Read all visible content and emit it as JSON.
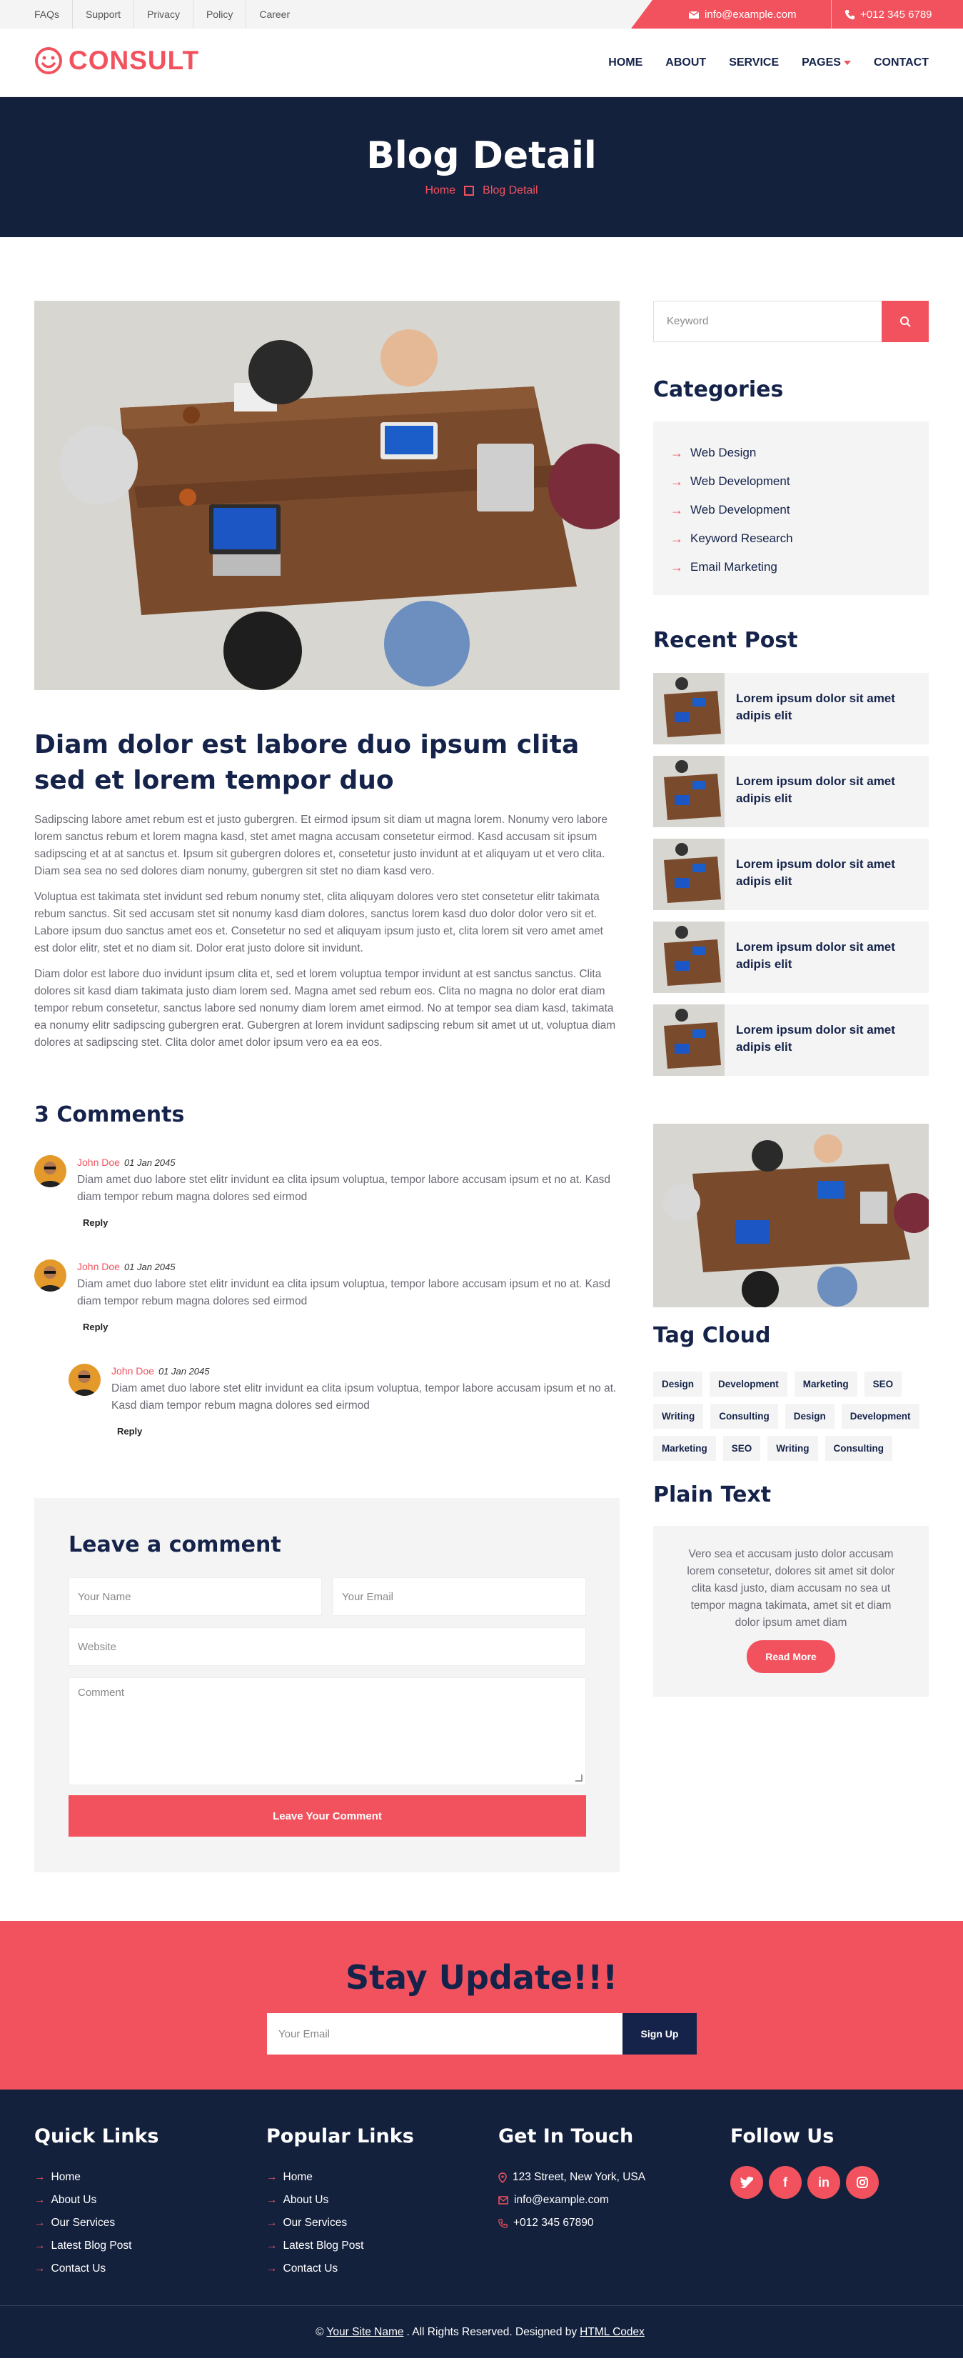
{
  "topbar": {
    "links": [
      "FAQs",
      "Support",
      "Privacy",
      "Policy",
      "Career"
    ],
    "email": "info@example.com",
    "phone": "+012 345 6789"
  },
  "nav": {
    "brand": "CONSULT",
    "items": [
      "HOME",
      "ABOUT",
      "SERVICE",
      "PAGES",
      "CONTACT"
    ],
    "active": "PAGES"
  },
  "header": {
    "title": "Blog Detail",
    "breadcrumb": [
      "Home",
      "Blog Detail"
    ]
  },
  "post": {
    "title": "Diam dolor est labore duo ipsum clita sed et lorem tempor duo",
    "paragraphs": [
      "Sadipscing labore amet rebum est et justo gubergren. Et eirmod ipsum sit diam ut magna lorem. Nonumy vero labore lorem sanctus rebum et lorem magna kasd, stet amet magna accusam consetetur eirmod. Kasd accusam sit ipsum sadipscing et at at sanctus et. Ipsum sit gubergren dolores et, consetetur justo invidunt at et aliquyam ut et vero clita. Diam sea sea no sed dolores diam nonumy, gubergren sit stet no diam kasd vero.",
      "Voluptua est takimata stet invidunt sed rebum nonumy stet, clita aliquyam dolores vero stet consetetur elitr takimata rebum sanctus. Sit sed accusam stet sit nonumy kasd diam dolores, sanctus lorem kasd duo dolor dolor vero sit et. Labore ipsum duo sanctus amet eos et. Consetetur no sed et aliquyam ipsum justo et, clita lorem sit vero amet amet est dolor elitr, stet et no diam sit. Dolor erat justo dolore sit invidunt.",
      "Diam dolor est labore duo invidunt ipsum clita et, sed et lorem voluptua tempor invidunt at est sanctus sanctus. Clita dolores sit kasd diam takimata justo diam lorem sed. Magna amet sed rebum eos. Clita no magna no dolor erat diam tempor rebum consetetur, sanctus labore sed nonumy diam lorem amet eirmod. No at tempor sea diam kasd, takimata ea nonumy elitr sadipscing gubergren erat. Gubergren at lorem invidunt sadipscing rebum sit amet ut ut, voluptua diam dolores at sadipscing stet. Clita dolor amet dolor ipsum vero ea ea eos."
    ]
  },
  "comments": {
    "heading": "3 Comments",
    "items": [
      {
        "name": "John Doe",
        "date": "01 Jan 2045",
        "text": "Diam amet duo labore stet elitr invidunt ea clita ipsum voluptua, tempor labore accusam ipsum et no at. Kasd diam tempor rebum magna dolores sed eirmod",
        "reply": "Reply"
      },
      {
        "name": "John Doe",
        "date": "01 Jan 2045",
        "text": "Diam amet duo labore stet elitr invidunt ea clita ipsum voluptua, tempor labore accusam ipsum et no at. Kasd diam tempor rebum magna dolores sed eirmod",
        "reply": "Reply"
      },
      {
        "name": "John Doe",
        "date": "01 Jan 2045",
        "text": "Diam amet duo labore stet elitr invidunt ea clita ipsum voluptua, tempor labore accusam ipsum et no at. Kasd diam tempor rebum magna dolores sed eirmod",
        "reply": "Reply"
      }
    ]
  },
  "form": {
    "heading": "Leave a comment",
    "name_placeholder": "Your Name",
    "email_placeholder": "Your Email",
    "website_placeholder": "Website",
    "comment_placeholder": "Comment",
    "submit": "Leave Your Comment"
  },
  "sidebar": {
    "search_placeholder": "Keyword",
    "categories_heading": "Categories",
    "categories": [
      "Web Design",
      "Web Development",
      "Web Development",
      "Keyword Research",
      "Email Marketing"
    ],
    "recent_heading": "Recent Post",
    "recent": [
      "Lorem ipsum dolor sit amet adipis elit",
      "Lorem ipsum dolor sit amet adipis elit",
      "Lorem ipsum dolor sit amet adipis elit",
      "Lorem ipsum dolor sit amet adipis elit",
      "Lorem ipsum dolor sit amet adipis elit"
    ],
    "tags_heading": "Tag Cloud",
    "tags": [
      "Design",
      "Development",
      "Marketing",
      "SEO",
      "Writing",
      "Consulting",
      "Design",
      "Development",
      "Marketing",
      "SEO",
      "Writing",
      "Consulting"
    ],
    "plain_heading": "Plain Text",
    "plain_text": "Vero sea et accusam justo dolor accusam lorem consetetur, dolores sit amet sit dolor clita kasd justo, diam accusam no sea ut tempor magna takimata, amet sit et diam dolor ipsum amet diam",
    "read_more": "Read More"
  },
  "newsletter": {
    "heading": "Stay Update!!!",
    "placeholder": "Your Email",
    "button": "Sign Up"
  },
  "footer": {
    "quick_heading": "Quick Links",
    "quick": [
      "Home",
      "About Us",
      "Our Services",
      "Latest Blog Post",
      "Contact Us"
    ],
    "popular_heading": "Popular Links",
    "popular": [
      "Home",
      "About Us",
      "Our Services",
      "Latest Blog Post",
      "Contact Us"
    ],
    "touch_heading": "Get In Touch",
    "address": "123 Street, New York, USA",
    "email": "info@example.com",
    "phone": "+012 345 67890",
    "follow_heading": "Follow Us",
    "socials": [
      "twitter-icon",
      "facebook-icon",
      "linkedin-icon",
      "instagram-icon"
    ],
    "copyright_prefix": "©",
    "site_name": "Your Site Name",
    "rights": ". All Rights Reserved. Designed by",
    "designer": "HTML Codex"
  },
  "colors": {
    "accent": "#f2525e",
    "dark": "#14213d",
    "light": "#f4f4f4"
  }
}
